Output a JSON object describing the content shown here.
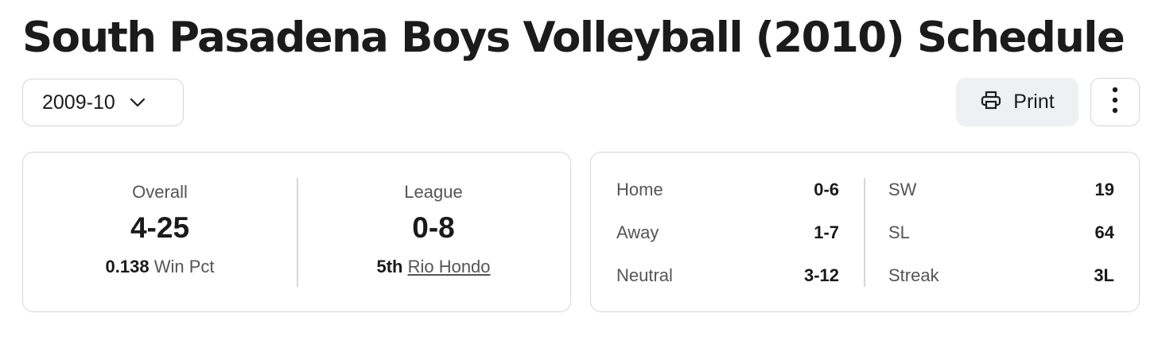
{
  "header": {
    "title": "South Pasadena Boys Volleyball (2010) Schedule"
  },
  "season_select": {
    "value": "2009-10",
    "icon": "chevron-down-icon"
  },
  "toolbar": {
    "print_label": "Print",
    "print_icon": "printer-icon",
    "more_icon": "vertical-dots-icon"
  },
  "record": {
    "overall": {
      "label": "Overall",
      "value": "4-25",
      "win_pct": "0.138",
      "win_pct_label": "Win Pct"
    },
    "league": {
      "label": "League",
      "value": "0-8",
      "place": "5th",
      "league_name": "Rio Hondo"
    }
  },
  "splits": {
    "left": [
      {
        "label": "Home",
        "value": "0-6"
      },
      {
        "label": "Away",
        "value": "1-7"
      },
      {
        "label": "Neutral",
        "value": "3-12"
      }
    ],
    "right": [
      {
        "label": "SW",
        "value": "19"
      },
      {
        "label": "SL",
        "value": "64"
      },
      {
        "label": "Streak",
        "value": "3L"
      }
    ]
  },
  "colors": {
    "border": "#d6d6d6",
    "print_bg": "#eef0f3",
    "text": "#1c1c1c",
    "muted": "#555555"
  }
}
